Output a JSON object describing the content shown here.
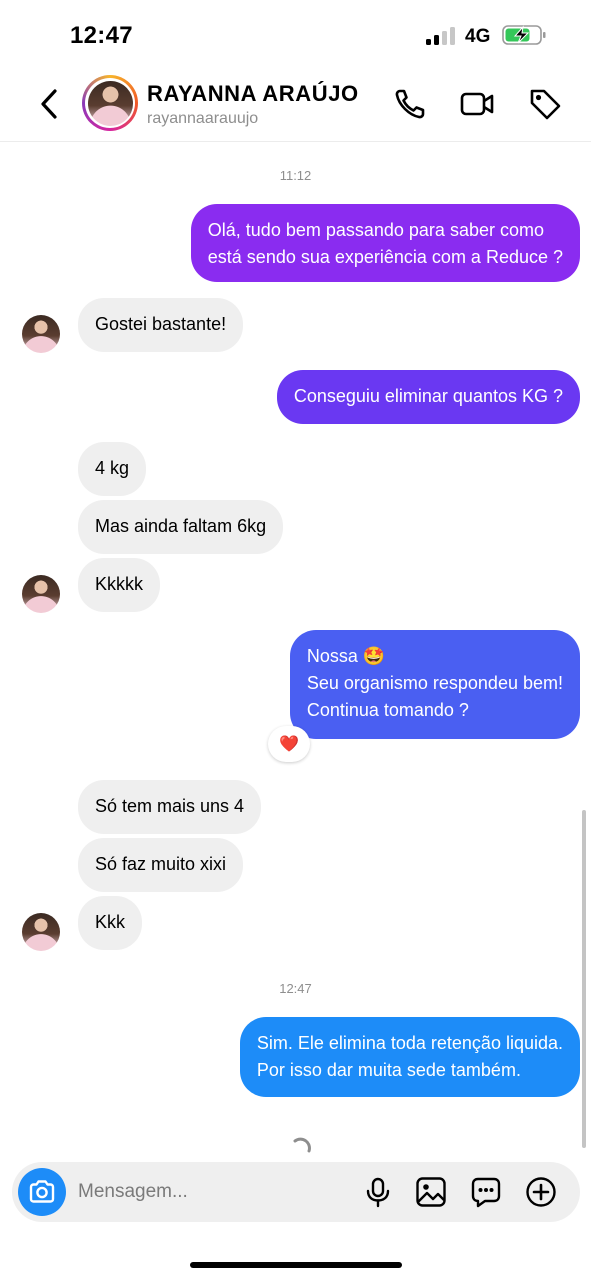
{
  "status_bar": {
    "time": "12:47",
    "network": "4G"
  },
  "header": {
    "name": "RAYANNA ARAÚJO",
    "username": "rayannaarauujo",
    "icons": [
      "back-icon",
      "phone-icon",
      "video-icon",
      "tag-icon"
    ]
  },
  "chat": {
    "timestamps": [
      "11:12",
      "12:47"
    ],
    "messages": [
      {
        "from": "me",
        "lines": [
          "Olá, tudo bem passando para saber como",
          "está sendo sua experiência com a Reduce ?"
        ]
      },
      {
        "from": "contact",
        "lines": [
          "Gostei bastante!"
        ]
      },
      {
        "from": "me",
        "lines": [
          "Conseguiu eliminar quantos KG ?"
        ]
      },
      {
        "from": "contact",
        "lines": [
          "4 kg"
        ]
      },
      {
        "from": "contact",
        "lines": [
          "Mas ainda faltam 6kg"
        ]
      },
      {
        "from": "contact",
        "lines": [
          "Kkkkk"
        ]
      },
      {
        "from": "me",
        "lines": [
          "Nossa 🤩",
          "Seu organismo respondeu bem!",
          "Continua tomando ?"
        ],
        "reaction": "❤️"
      },
      {
        "from": "contact",
        "lines": [
          "Só tem mais uns 4"
        ]
      },
      {
        "from": "contact",
        "lines": [
          "Só faz muito xixi"
        ]
      },
      {
        "from": "contact",
        "lines": [
          "Kkk"
        ]
      },
      {
        "from": "me",
        "lines": [
          "Sim. Ele elimina toda retenção liquida.",
          "Por isso dar muita sede também."
        ]
      }
    ]
  },
  "composer": {
    "placeholder": "Mensagem...",
    "icons": [
      "camera-icon",
      "microphone-icon",
      "gallery-icon",
      "sticker-icon",
      "plus-icon"
    ]
  },
  "colors": {
    "bubble_purple_top": "#8a2cf0",
    "bubble_indigo": "#5a3ef2",
    "bubble_blue": "#4a5ff2",
    "bubble_bottom_blue": "#1d8cf8",
    "received_bubble": "#efefef",
    "camera_button": "#1d8cf8",
    "battery_green": "#34c759"
  }
}
